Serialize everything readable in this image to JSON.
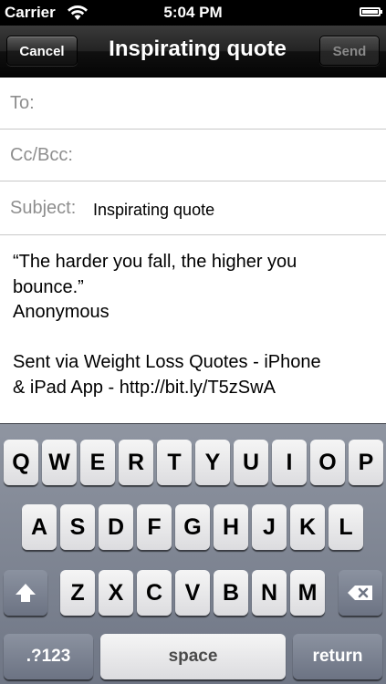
{
  "status_bar": {
    "carrier": "Carrier",
    "time": "5:04 PM",
    "wifi_icon": "wifi-icon",
    "battery_icon": "battery-icon"
  },
  "nav": {
    "cancel_label": "Cancel",
    "title": "Inspirating quote",
    "send_label": "Send"
  },
  "fields": {
    "to_label": "To:",
    "to_value": "",
    "ccbcc_label": "Cc/Bcc:",
    "ccbcc_value": "",
    "subject_label": "Subject:",
    "subject_value": "Inspirating quote"
  },
  "body": {
    "lines": [
      "“The harder you fall, the higher you",
      "bounce.”",
      "Anonymous",
      "",
      "Sent via Weight Loss Quotes - iPhone",
      "& iPad App - http://bit.ly/T5zSwA"
    ]
  },
  "keyboard": {
    "row1": [
      "Q",
      "W",
      "E",
      "R",
      "T",
      "Y",
      "U",
      "I",
      "O",
      "P"
    ],
    "row2": [
      "A",
      "S",
      "D",
      "F",
      "G",
      "H",
      "J",
      "K",
      "L"
    ],
    "row3": [
      "Z",
      "X",
      "C",
      "V",
      "B",
      "N",
      "M"
    ],
    "shift_icon": "shift-arrow-icon",
    "delete_icon": "backspace-icon",
    "numbers_label": ".?123",
    "space_label": "space",
    "return_label": "return"
  },
  "colors": {
    "nav_background": "#1a1a1a",
    "keyboard_background": "#7d8492",
    "label_gray": "#8e8e8e"
  }
}
